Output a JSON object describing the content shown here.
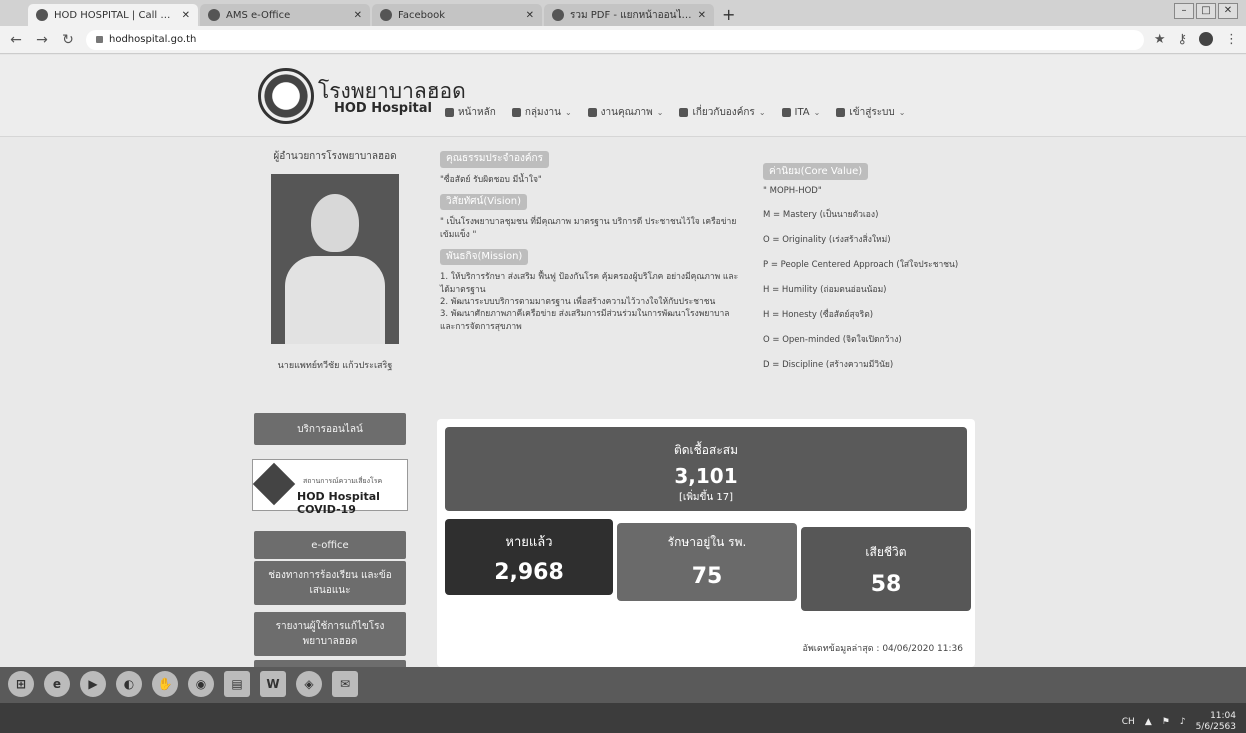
{
  "browser": {
    "tabs": [
      {
        "label": "HOD HOSPITAL | Call 053-461014",
        "active": true
      },
      {
        "label": "AMS e-Office",
        "active": false
      },
      {
        "label": "Facebook",
        "active": false
      },
      {
        "label": "รวม PDF - แยกหน้าออนไลน์ฟรี",
        "active": false
      }
    ],
    "new_tab": "+",
    "url": "hodhospital.go.th"
  },
  "site": {
    "name_th": "โรงพยาบาลฮอด",
    "name_en": "HOD Hospital",
    "nav": [
      {
        "label": "หน้าหลัก",
        "dropdown": false
      },
      {
        "label": "กลุ่มงาน",
        "dropdown": true
      },
      {
        "label": "งานคุณภาพ",
        "dropdown": true
      },
      {
        "label": "เกี่ยวกับองค์กร",
        "dropdown": true
      },
      {
        "label": "ITA",
        "dropdown": true
      },
      {
        "label": "เข้าสู่ระบบ",
        "dropdown": true
      }
    ]
  },
  "sidebar": {
    "director_title": "ผู้อำนวยการโรงพยาบาลฮอด",
    "director_name": "นายแพทย์ทวีชัย แก้วประเสริฐ",
    "buttons": {
      "online": "บริการออนไลน์",
      "eoffice": "e-office",
      "complaint": "ช่องทางการร้องเรียน และข้อเสนอแนะ",
      "report": "รายงานผู้ใช้การแก้ไขโรงพยาบาลฮอด"
    },
    "covid_banner": {
      "line1": "สถานการณ์ความเสี่ยงโรค",
      "line2": "HOD Hospital COVID-19"
    }
  },
  "mission": {
    "principle_heading": "คุณธรรมประจำองค์กร",
    "principle_text": "\"ซื่อสัตย์ รับผิดชอบ มีน้ำใจ\"",
    "vision_heading": "วิสัยทัศน์(Vision)",
    "vision_text": "\" เป็นโรงพยาบาลชุมชน ที่มีคุณภาพ มาตรฐาน บริการดี ประชาชนไว้ใจ เครือข่ายเข้มแข็ง \"",
    "mission_heading": "พันธกิจ(Mission)",
    "mission_items": [
      "1. ให้บริการรักษา ส่งเสริม ฟื้นฟู ป้องกันโรค คุ้มครองผู้บริโภค อย่างมีคุณภาพ และได้มาตรฐาน",
      "2. พัฒนาระบบบริการตามมาตรฐาน เพื่อสร้างความไว้วางใจให้กับประชาชน",
      "3. พัฒนาศักยภาพภาคีเครือข่าย ส่งเสริมการมีส่วนร่วมในการพัฒนาโรงพยาบาลและการจัดการสุขภาพ"
    ]
  },
  "values": {
    "heading": "ค่านิยม(Core Value)",
    "motto": "\" MOPH-HOD\"",
    "items": [
      "M = Mastery (เป็นนายตัวเอง)",
      "O = Originality (เร่งสร้างสิ่งใหม่)",
      "P = People Centered Approach (ใส่ใจประชาชน)",
      "H = Humility (ถ่อมตนอ่อนน้อม)",
      "H = Honesty (ซื่อสัตย์สุจริต)",
      "O = Open-minded (จิตใจเปิดกว้าง)",
      "D = Discipline (สร้างความมีวินัย)"
    ]
  },
  "covid": {
    "total_label": "ติดเชื้อสะสม",
    "total_value": "3,101",
    "total_delta": "[เพิ่มขึ้น 17]",
    "recovered_label": "หายแล้ว",
    "recovered_value": "2,968",
    "hospital_label": "รักษาอยู่ใน รพ.",
    "hospital_value": "75",
    "deaths_label": "เสียชีวิต",
    "deaths_value": "58",
    "updated": "อัพเดทข้อมูลล่าสุด : 04/06/2020 11:36"
  },
  "taskbar": {
    "tray_lang": "CH",
    "time": "11:04",
    "date": "5/6/2563"
  }
}
